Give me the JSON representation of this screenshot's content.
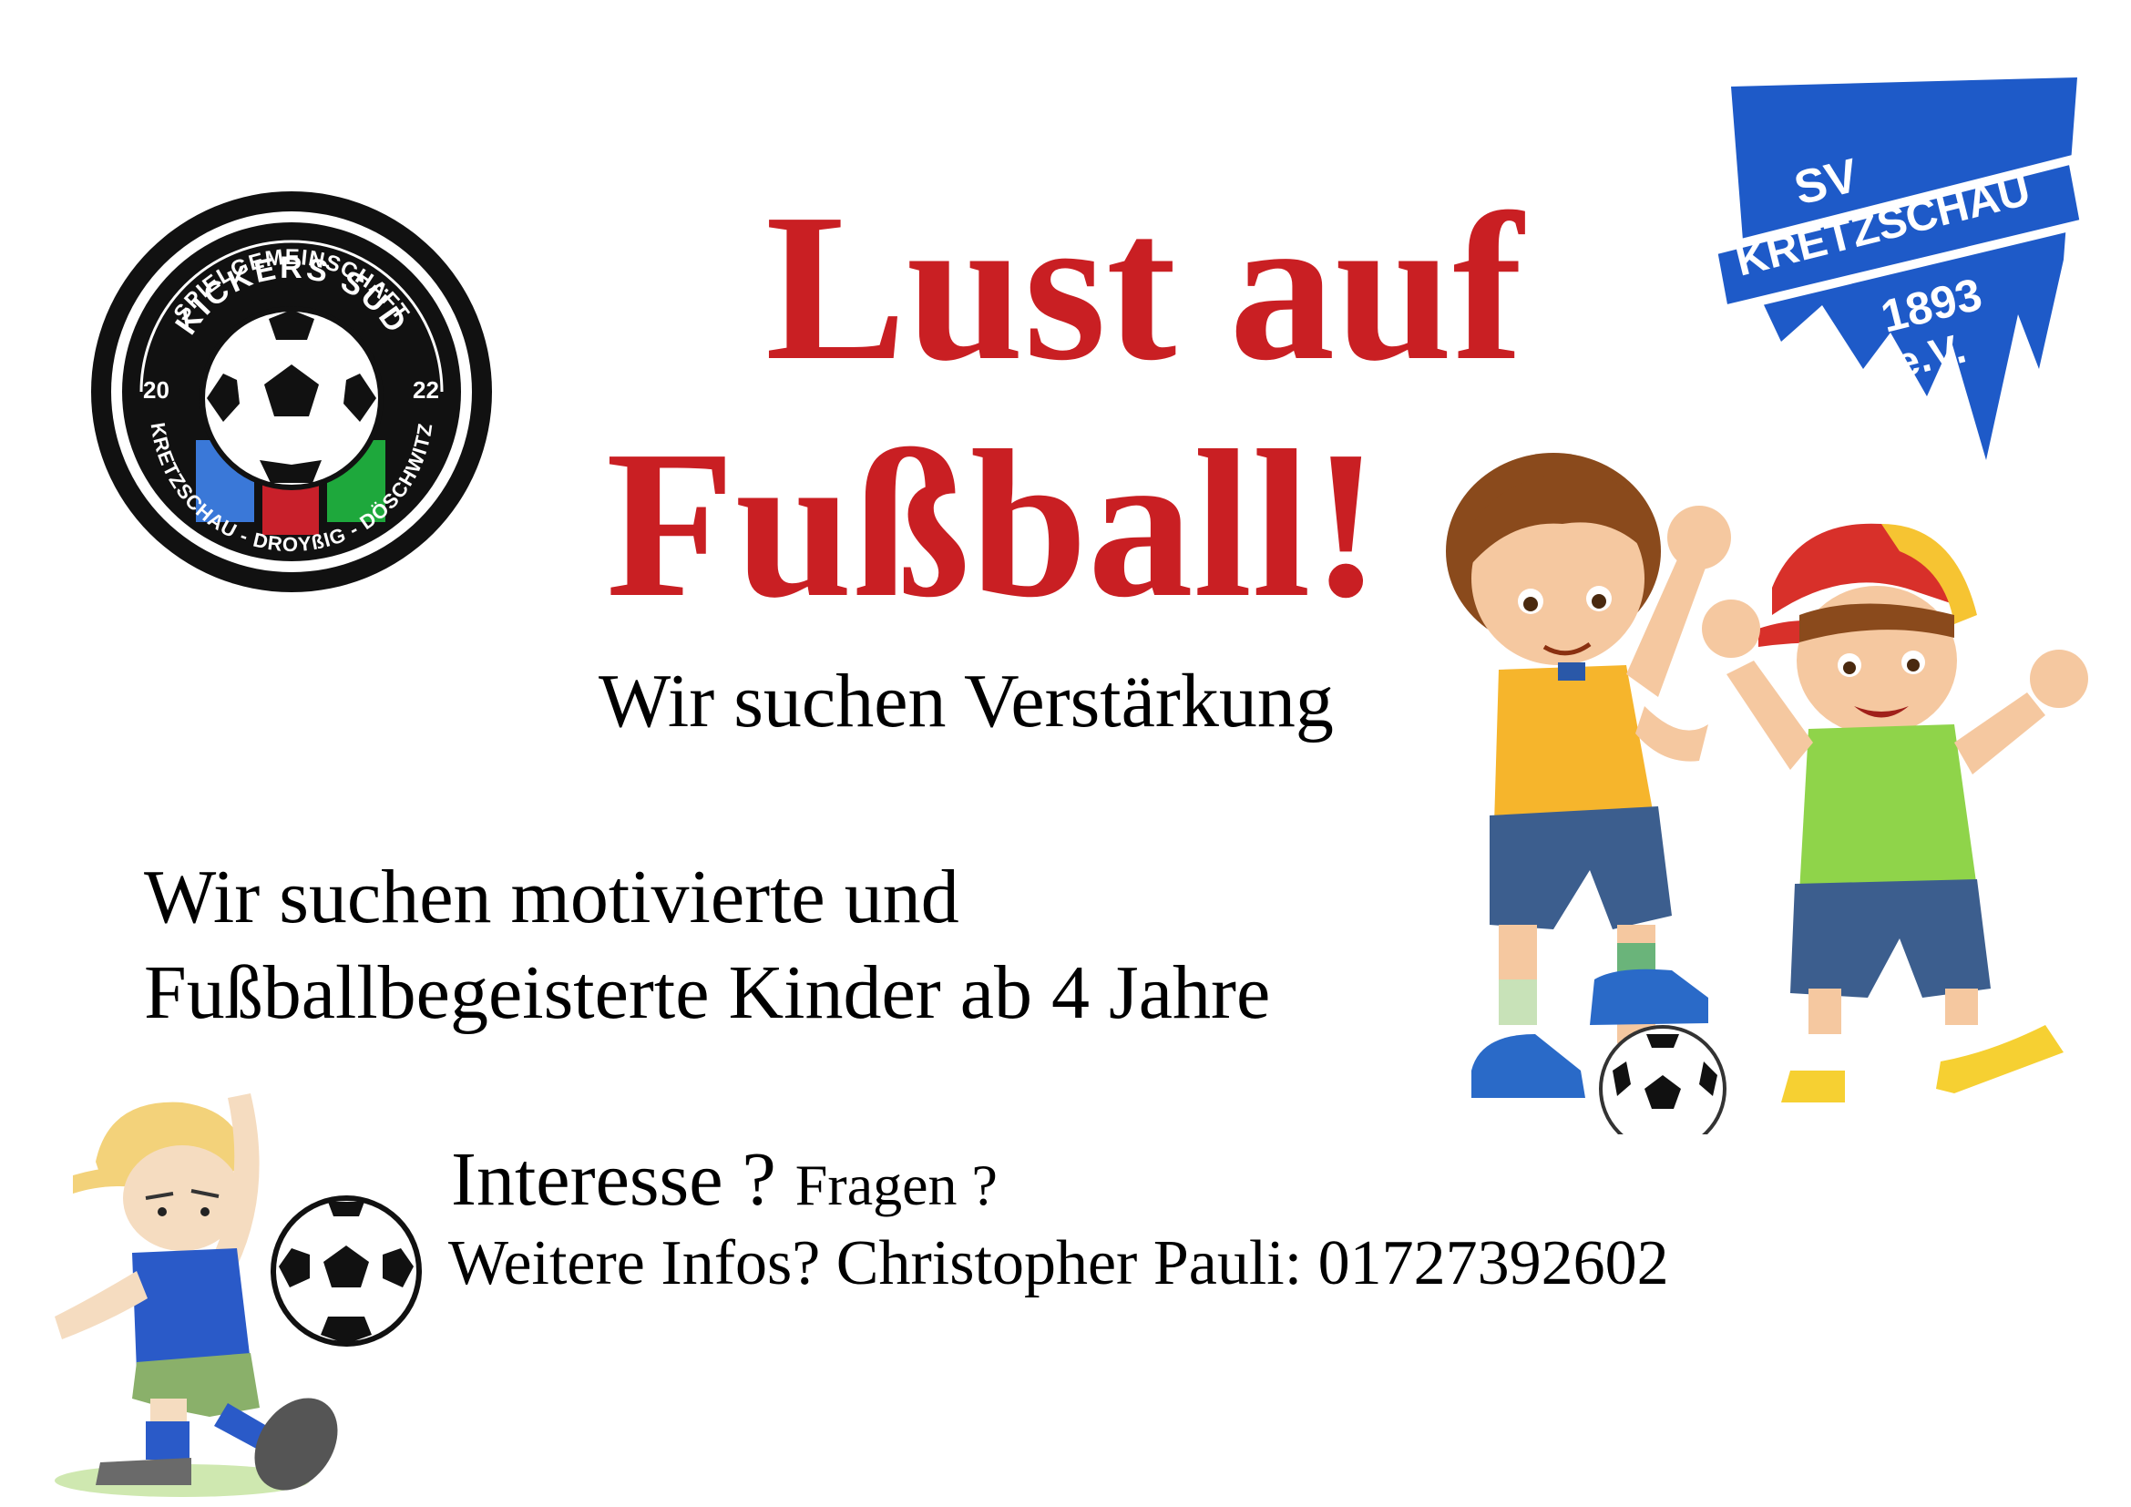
{
  "flyer": {
    "headline_line1": "Lust auf",
    "headline_line2": "Fußball!",
    "subtitle": "Wir suchen Verstärkung",
    "description_line1": "Wir suchen motivierte und",
    "description_line2": "Fußballbegeisterte Kinder ab 4 Jahre",
    "interest_large": "Interesse ?",
    "interest_small": "Fragen ?",
    "contact": "Weitere Infos? Christopher Pauli: 01727392602"
  },
  "logo_left": {
    "top_text": "SPIELGEMEINSCHAFT",
    "name": "KICKERS SÜD",
    "year_left": "20",
    "year_right": "22",
    "bottom_text": "KRETZSCHAU - DROYßIG - DÖSCHWITZ"
  },
  "logo_right": {
    "line1": "SV",
    "line2": "KRETZSCHAU",
    "line3": "1893",
    "line4": "e.V."
  },
  "colors": {
    "headline": "#c91f23",
    "text": "#000000",
    "club_blue": "#1e5ac8",
    "stripe_blue": "#3a78d8",
    "stripe_red": "#c8202a",
    "stripe_green": "#1ea83c"
  },
  "icons": [
    "kickers-sued-logo",
    "sv-kretzschau-crest",
    "two-boys-football-illustration",
    "kicking-boy-illustration",
    "football-icon"
  ]
}
